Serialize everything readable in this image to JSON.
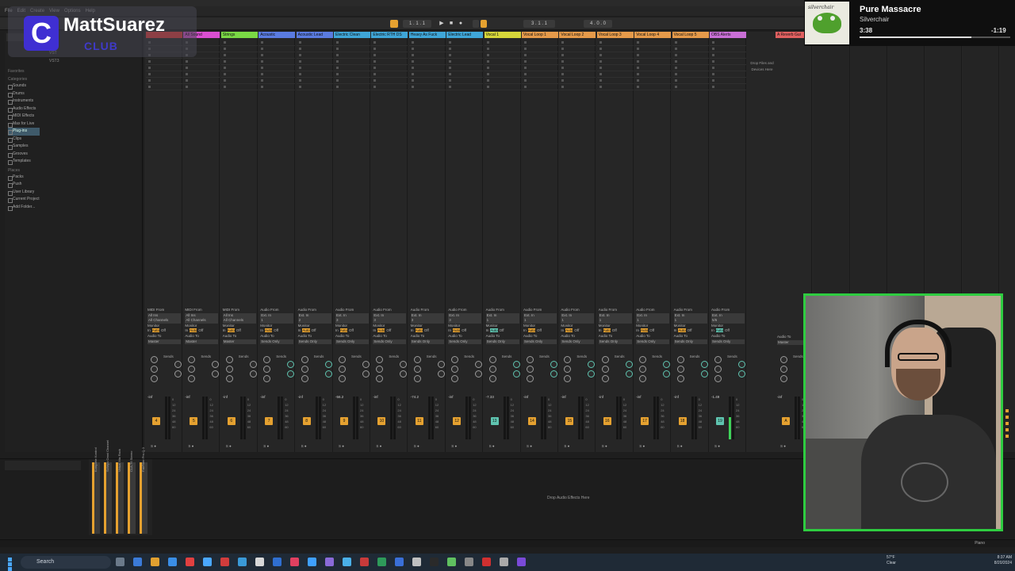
{
  "overlay": {
    "brand_letter": "C",
    "brand_name": "MattSuarez",
    "brand_sub": "CLUB"
  },
  "menu": [
    "File",
    "Edit",
    "Create",
    "View",
    "Options",
    "Help"
  ],
  "transport": {
    "position": "1 . 1 . 1",
    "loop": "3 . 1 . 1",
    "end": "4 . 0 . 0"
  },
  "browser": {
    "files": [
      "VST",
      "VST3"
    ],
    "sections": [
      {
        "head": "Favorites",
        "items": []
      },
      {
        "head": "Categories",
        "items": [
          "Sounds",
          "Drums",
          "Instruments",
          "Audio Effects",
          "MIDI Effects",
          "Max for Live",
          "Plug-ins",
          "Clips",
          "Samples",
          "Grooves",
          "Templates"
        ]
      },
      {
        "head": "Places",
        "items": [
          "Packs",
          "Push",
          "User Library",
          "Current Project",
          "Add Folder..."
        ]
      }
    ],
    "selected": "Plug-ins"
  },
  "tracks": [
    {
      "name": "",
      "color": "#e53838",
      "num": "4",
      "vol": "-inf",
      "in_from": "MIDI From",
      "in_ch": "All Ins",
      "in_sub": "All Channels"
    },
    {
      "name": "All Sound",
      "color": "#d94fd0",
      "num": "5",
      "vol": "-inf",
      "in_from": "MIDI From",
      "in_ch": "All Ins",
      "in_sub": "All Channels"
    },
    {
      "name": "Strings",
      "color": "#7ad845",
      "num": "6",
      "vol": "-inf",
      "in_from": "MIDI From",
      "in_ch": "All Ins",
      "in_sub": "All Channels"
    },
    {
      "name": "Acoustic",
      "color": "#5a7be0",
      "num": "7",
      "vol": "-inf",
      "in_from": "Audio From",
      "in_ch": "Ext. In",
      "in_sub": "1"
    },
    {
      "name": "Acoustic Lead",
      "color": "#5a7be0",
      "num": "8",
      "vol": "-inf",
      "in_from": "Audio From",
      "in_ch": "Ext. In",
      "in_sub": "2"
    },
    {
      "name": "Electric Clean",
      "color": "#3fa6d8",
      "num": "9",
      "vol": "-56.2",
      "in_from": "Audio From",
      "in_ch": "Ext. In",
      "in_sub": "3"
    },
    {
      "name": "Electric RTH DS",
      "color": "#3fa6d8",
      "num": "10",
      "vol": "-inf",
      "in_from": "Audio From",
      "in_ch": "Ext. In",
      "in_sub": "3"
    },
    {
      "name": "Heavy As Fuck",
      "color": "#3fa6d8",
      "num": "11",
      "vol": "-74.2",
      "in_from": "Audio From",
      "in_ch": "Ext. In",
      "in_sub": "3"
    },
    {
      "name": "Electric Lead",
      "color": "#3fa6d8",
      "num": "12",
      "vol": "-inf",
      "in_from": "Audio From",
      "in_ch": "Ext. In",
      "in_sub": "3"
    },
    {
      "name": "Vocal 1",
      "color": "#d6d63a",
      "num": "13",
      "vol": "-7.33",
      "in_from": "Audio From",
      "in_ch": "Ext. In",
      "in_sub": "1"
    },
    {
      "name": "Vocal Loop 1",
      "color": "#e59a4a",
      "num": "14",
      "vol": "-inf",
      "in_from": "Audio From",
      "in_ch": "Ext. In",
      "in_sub": "1"
    },
    {
      "name": "Vocal Loop 2",
      "color": "#e59a4a",
      "num": "15",
      "vol": "-inf",
      "in_from": "Audio From",
      "in_ch": "Ext. In",
      "in_sub": "1"
    },
    {
      "name": "Vocal Loop 3",
      "color": "#e59a4a",
      "num": "16",
      "vol": "-inf",
      "in_from": "Audio From",
      "in_ch": "Ext. In",
      "in_sub": "1"
    },
    {
      "name": "Vocal Loop 4",
      "color": "#e59a4a",
      "num": "17",
      "vol": "-inf",
      "in_from": "Audio From",
      "in_ch": "Ext. In",
      "in_sub": "1"
    },
    {
      "name": "Vocal Loop 5",
      "color": "#e59a4a",
      "num": "18",
      "vol": "-inf",
      "in_from": "Audio From",
      "in_ch": "Ext. In",
      "in_sub": "1"
    },
    {
      "name": "OBS Alerts",
      "color": "#c96fd6",
      "num": "19",
      "vol": "-1.49",
      "in_from": "Audio From",
      "in_ch": "Ext. In",
      "in_sub": "5/6"
    }
  ],
  "return_track": {
    "name": "A Reverb Gui",
    "color": "#e06060",
    "num": "A",
    "vol": "-inf"
  },
  "mixer_labels": {
    "monitor": "Monitor",
    "in": "In",
    "auto": "Auto",
    "off": "Off",
    "audio_to": "Audio To",
    "master": "Master",
    "sends_only": "Sends Only",
    "sends": "Sends"
  },
  "drop_files": "Drop Files and Devices Here",
  "devices": {
    "chain": [
      "Komplete Kontrol",
      "Scheps Omni Channel",
      "Virtual Mix Rack",
      "CLA-76 Stereo",
      "FabFilter Pro-Q 3"
    ],
    "drop_audio": "Drop Audio Effects Here"
  },
  "status": {
    "piano": "Piano"
  },
  "now_playing": {
    "title": "Pure Massacre",
    "artist": "Silverchair",
    "elapsed": "3:38",
    "remaining": "-1:19",
    "progress": 0.74,
    "album_text": "silverchair"
  },
  "taskbar": {
    "search": "Search",
    "temp": "57°F",
    "weather": "Clear",
    "time": "8:37 AM",
    "date": "8/20/2024"
  }
}
